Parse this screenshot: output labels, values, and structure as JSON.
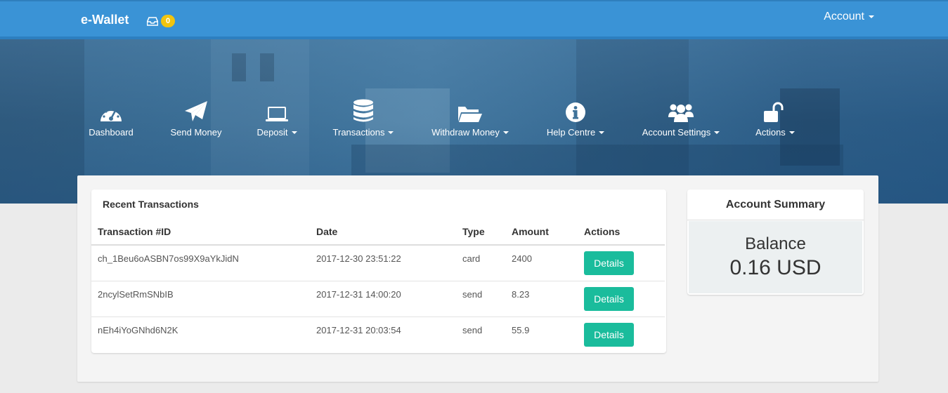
{
  "app": {
    "brand": "e-Wallet",
    "inbox_count": "0",
    "account_label": "Account"
  },
  "nav": [
    {
      "label": "Dashboard",
      "icon": "dashboard-icon",
      "dropdown": false
    },
    {
      "label": "Send Money",
      "icon": "paper-plane-icon",
      "dropdown": false
    },
    {
      "label": "Deposit",
      "icon": "laptop-icon",
      "dropdown": true
    },
    {
      "label": "Transactions",
      "icon": "database-icon",
      "dropdown": true
    },
    {
      "label": "Withdraw Money",
      "icon": "folder-open-icon",
      "dropdown": true
    },
    {
      "label": "Help Centre",
      "icon": "info-icon",
      "dropdown": true
    },
    {
      "label": "Account Settings",
      "icon": "users-icon",
      "dropdown": true
    },
    {
      "label": "Actions",
      "icon": "unlock-icon",
      "dropdown": true
    }
  ],
  "transactions": {
    "title": "Recent Transactions",
    "headers": {
      "id": "Transaction #ID",
      "date": "Date",
      "type": "Type",
      "amount": "Amount",
      "actions": "Actions"
    },
    "rows": [
      {
        "id": "ch_1Beu6oASBN7os99X9aYkJidN",
        "date": "2017-12-30 23:51:22",
        "type": "card",
        "amount": "2400",
        "action": "Details"
      },
      {
        "id": "2ncylSetRmSNbIB",
        "date": "2017-12-31 14:00:20",
        "type": "send",
        "amount": "8.23",
        "action": "Details"
      },
      {
        "id": "nEh4iYoGNhd6N2K",
        "date": "2017-12-31 20:03:54",
        "type": "send",
        "amount": "55.9",
        "action": "Details"
      }
    ]
  },
  "summary": {
    "title": "Account Summary",
    "balance_label": "Balance",
    "balance_value": "0.16 USD"
  },
  "colors": {
    "header": "#3a93d6",
    "button": "#1abc9c",
    "badge": "#f1c40f"
  }
}
